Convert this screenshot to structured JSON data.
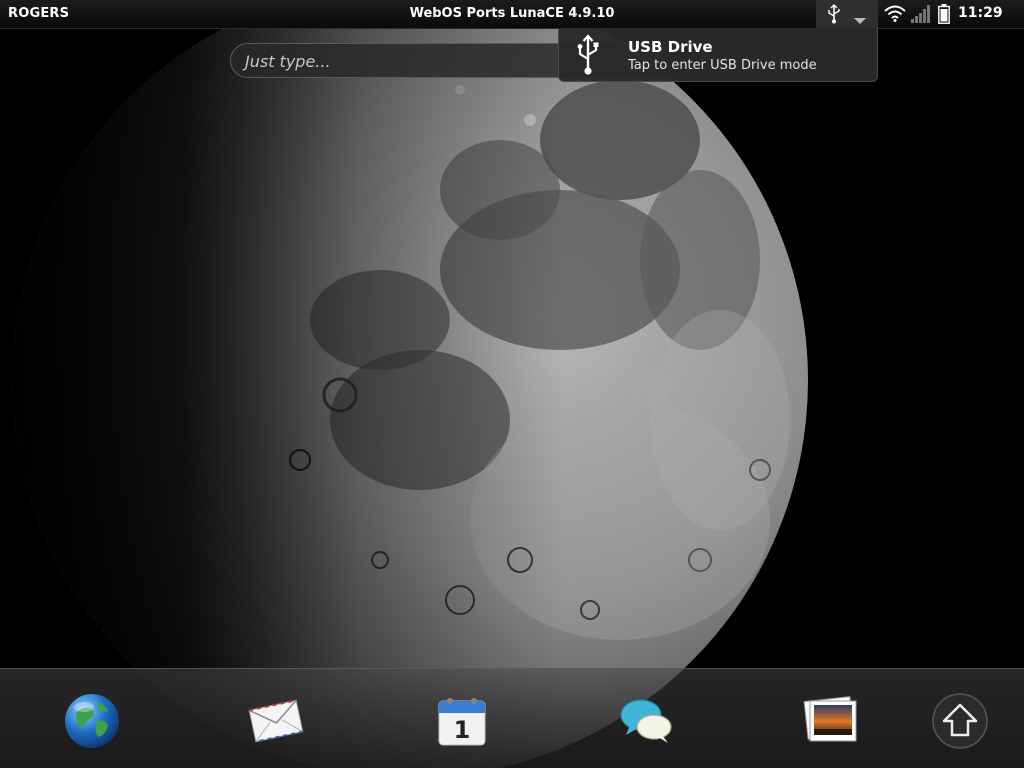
{
  "statusbar": {
    "carrier": "ROGERS",
    "app_title": "WebOS Ports LunaCE 4.9.10",
    "clock": "11:29",
    "icons": [
      "usb-icon",
      "dropdown-arrow-icon",
      "wifi-icon",
      "signal-icon",
      "battery-icon"
    ]
  },
  "search": {
    "placeholder": "Just type..."
  },
  "notification": {
    "icon": "usb-icon",
    "title": "USB Drive",
    "subtitle": "Tap to enter USB Drive mode"
  },
  "dock": {
    "items": [
      {
        "icon": "web-browser-icon"
      },
      {
        "icon": "email-icon"
      },
      {
        "icon": "calendar-icon",
        "day": "1"
      },
      {
        "icon": "messaging-icon"
      },
      {
        "icon": "photos-icon"
      },
      {
        "icon": "launcher-icon"
      }
    ]
  },
  "colors": {
    "statusbar_bg": "#111111",
    "notification_bg": "#2a2a2a",
    "text": "#ffffff"
  }
}
